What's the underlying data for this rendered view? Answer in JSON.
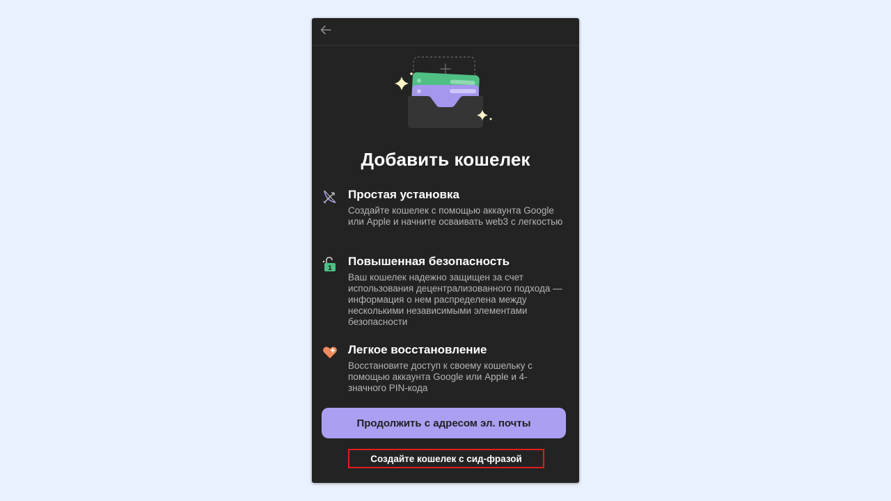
{
  "header": {
    "back_icon": "arrow-left-icon"
  },
  "hero": {
    "icon": "wallet-illustration"
  },
  "title": "Добавить кошелек",
  "features": [
    {
      "icon": "bow-arrow-icon",
      "title": "Простая установка",
      "description": "Создайте кошелек с помощью аккаунта Google или Apple и начните осваивать web3 с легкостью"
    },
    {
      "icon": "padlock-icon",
      "title": "Повышенная безопасность",
      "description": "Ваш кошелек надежно защищен за счет использования децентрализованного подхода — информация о нем распределена между несколькими независимыми элементами безопасности"
    },
    {
      "icon": "heart-plus-icon",
      "title": "Легкое восстановление",
      "description": "Восстановите доступ к своему кошельку с помощью аккаунта Google или Apple и 4-значного PIN-кода"
    }
  ],
  "buttons": {
    "primary_label": "Продолжить с адресом эл. почты",
    "seed_label": "Создайте кошелек с сид-фразой"
  },
  "colors": {
    "background": "#e8f1fd",
    "panel": "#232323",
    "accent": "#ab9ff2",
    "highlight_border": "#e01d1d"
  }
}
